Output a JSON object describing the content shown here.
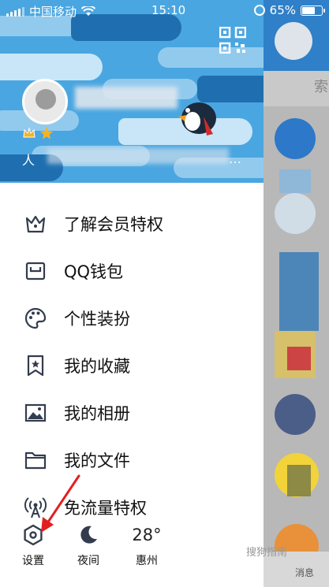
{
  "status_bar": {
    "carrier": "中国移动",
    "time": "15:10",
    "battery_percent": "65%",
    "battery_level": 0.65
  },
  "profile": {
    "level_prefix": "人",
    "more": "…"
  },
  "menu": {
    "items": [
      {
        "label": "了解会员特权",
        "icon": "crown-icon"
      },
      {
        "label": "QQ钱包",
        "icon": "wallet-icon"
      },
      {
        "label": "个性装扮",
        "icon": "palette-icon"
      },
      {
        "label": "我的收藏",
        "icon": "bookmark-star-icon"
      },
      {
        "label": "我的相册",
        "icon": "image-icon"
      },
      {
        "label": "我的文件",
        "icon": "folder-icon"
      },
      {
        "label": "免流量特权",
        "icon": "antenna-icon"
      }
    ]
  },
  "bottom_bar": {
    "settings_label": "设置",
    "night_label": "夜间",
    "temperature": "28°",
    "city": "惠州"
  },
  "background": {
    "search_hint": "索",
    "messages_tab": "消息",
    "watermark": "搜狗指南"
  },
  "colors": {
    "header_blue": "#4aa6e0",
    "icon_dark": "#333c4e",
    "annotation_red": "#e02020"
  }
}
